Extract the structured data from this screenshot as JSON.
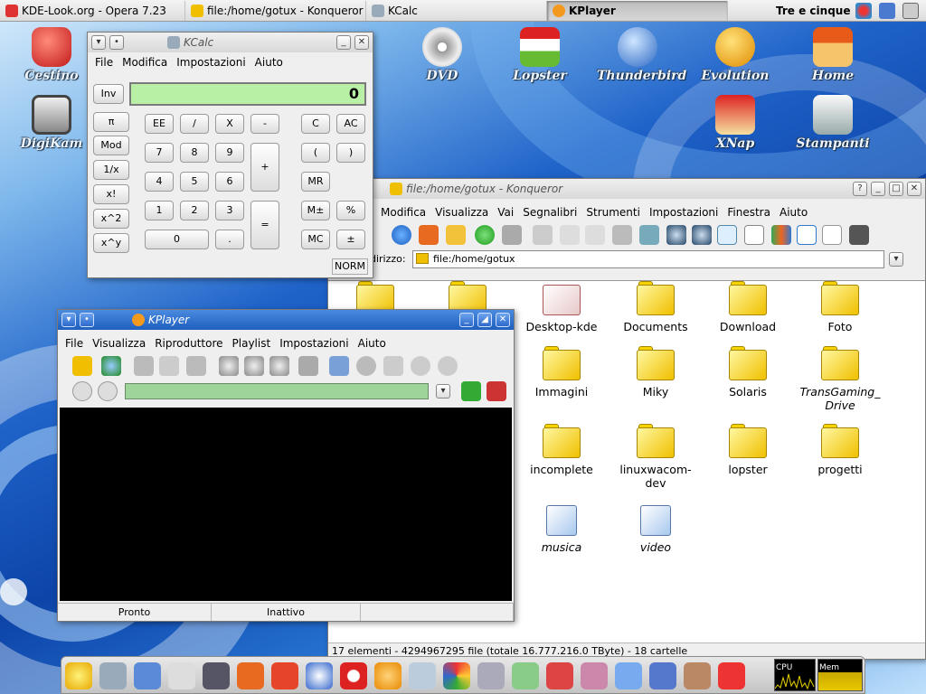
{
  "taskbar": {
    "tasks": [
      "KDE-Look.org - Opera 7.23",
      "file:/home/gotux - Konqueror",
      "KCalc",
      "KPlayer"
    ],
    "clock": "Tre e cinque"
  },
  "desktop": {
    "icons": [
      "Cestino",
      "DigiKam",
      "DVD",
      "Lopster",
      "Thunderbird",
      "Evolution",
      "Home",
      "XNap",
      "Stampanti"
    ]
  },
  "kcalc": {
    "title": "KCalc",
    "menu": [
      "File",
      "Modifica",
      "Impostazioni",
      "Aiuto"
    ],
    "display": "0",
    "inv": "Inv",
    "mode": "NORM",
    "left": [
      "π",
      "Mod",
      "1/x",
      "x!",
      "x^2",
      "x^y"
    ],
    "ops": [
      "EE",
      "/",
      "X",
      "-"
    ],
    "digits": [
      "7",
      "8",
      "9",
      "4",
      "5",
      "6",
      "1",
      "2",
      "3",
      "0",
      "."
    ],
    "plus": "+",
    "equals": "=",
    "right": [
      "C",
      "AC",
      "(",
      ")",
      "MR",
      "M±",
      "%",
      "MC",
      "±"
    ]
  },
  "konqueror": {
    "title": "file:/home/gotux - Konqueror",
    "menu": [
      "Modifica",
      "Visualizza",
      "Vai",
      "Segnalibri",
      "Strumenti",
      "Impostazioni",
      "Finestra",
      "Aiuto"
    ],
    "address_label": "dirizzo:",
    "address": "file:/home/gotux",
    "files": [
      "Desktop-kde",
      "Documents",
      "Download",
      "Foto",
      "Immagini",
      "Miky",
      "Solaris",
      "TransGaming_\nDrive",
      "incomplete",
      "linuxwacom-\ndev",
      "lopster",
      "progetti",
      "musica",
      "video"
    ],
    "status": "17 elementi - 4294967295 file (totale 16.777.216.0 TByte) - 18 cartelle"
  },
  "kplayer": {
    "title": "KPlayer",
    "menu": [
      "File",
      "Visualizza",
      "Riproduttore",
      "Playlist",
      "Impostazioni",
      "Aiuto"
    ],
    "status_left": "Pronto",
    "status_mid": "Inattivo"
  },
  "panel": {
    "graphs": [
      "CPU",
      "Mem"
    ]
  },
  "colors": {
    "titlebar_active": "#1f5fbe",
    "kcalc_display": "#b8f0a6",
    "folder": "#f0c000"
  }
}
